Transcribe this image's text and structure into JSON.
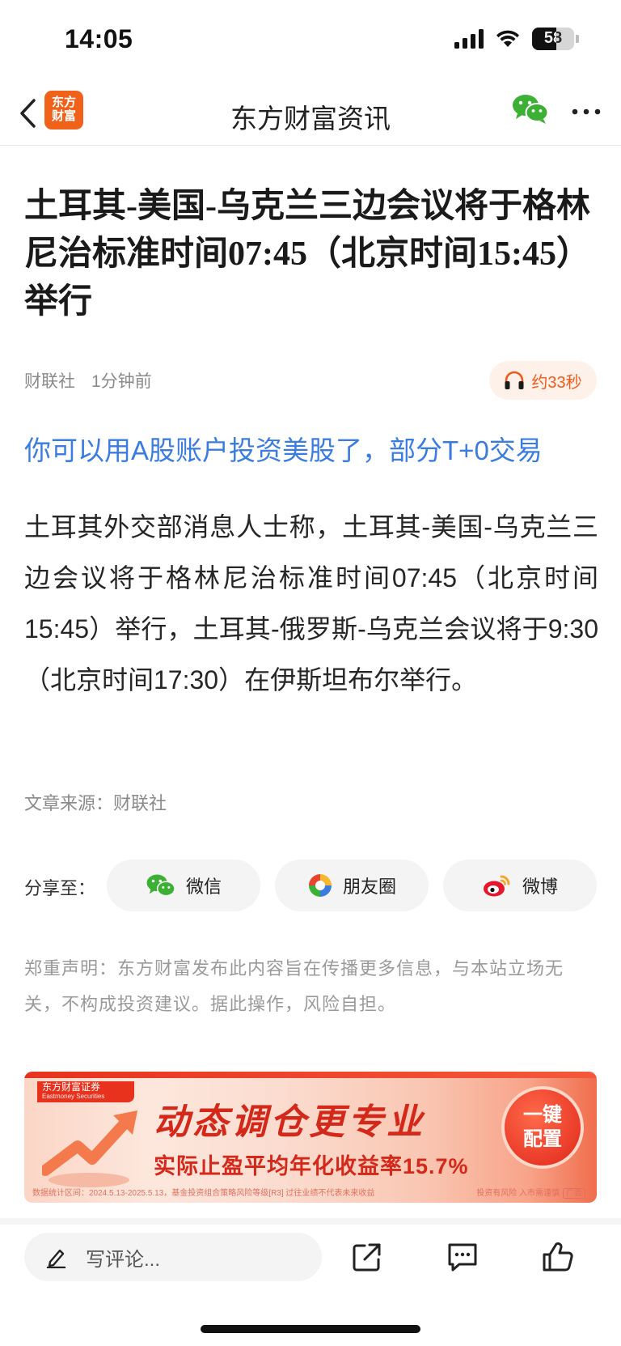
{
  "status_bar": {
    "time": "14:05",
    "battery": "58",
    "battery_level": 0.58
  },
  "nav": {
    "logo_line1": "东方",
    "logo_line2": "财富",
    "title": "东方财富资讯"
  },
  "article": {
    "title": "土耳其-美国-乌克兰三边会议将于格林尼治标准时间07:45（北京时间15:45）举行",
    "source_name": "财联社",
    "time_ago": "1分钟前",
    "audio_duration": "约33秒",
    "promo_link": "你可以用A股账户投资美股了，部分T+0交易",
    "body": "土耳其外交部消息人士称，土耳其-美国-乌克兰三边会议将于格林尼治标准时间07:45（北京时间15:45）举行，土耳其-俄罗斯-乌克兰会议将于9:30（北京时间17:30）在伊斯坦布尔举行。",
    "source_line": "文章来源：财联社"
  },
  "share": {
    "label": "分享至：",
    "wechat": "微信",
    "moments": "朋友圈",
    "weibo": "微博"
  },
  "disclaimer": {
    "label": "郑重声明：",
    "text": "东方财富发布此内容旨在传播更多信息，与本站立场无关，不构成投资建议。据此操作，风险自担。"
  },
  "ad": {
    "brand": "东方财富证券",
    "brand_en": "Eastmoney Securities",
    "headline": "动态调仓更专业",
    "subheadline": "实际止盈平均年化收益率15.7%",
    "cta_line1": "一键",
    "cta_line2": "配置",
    "footnote": "数据统计区间：2024.5.13-2025.5.13，基金投资组合策略风险等级[R3] 过往业绩不代表未来收益",
    "risk_note": "投资有风险 入市需谨慎",
    "tag": "广告"
  },
  "bottom_bar": {
    "comment_placeholder": "写评论..."
  },
  "colors": {
    "accent_orange": "#f0621a",
    "link_blue": "#3a7ce0",
    "wechat_green": "#3cb034",
    "ad_red": "#d4281a"
  }
}
